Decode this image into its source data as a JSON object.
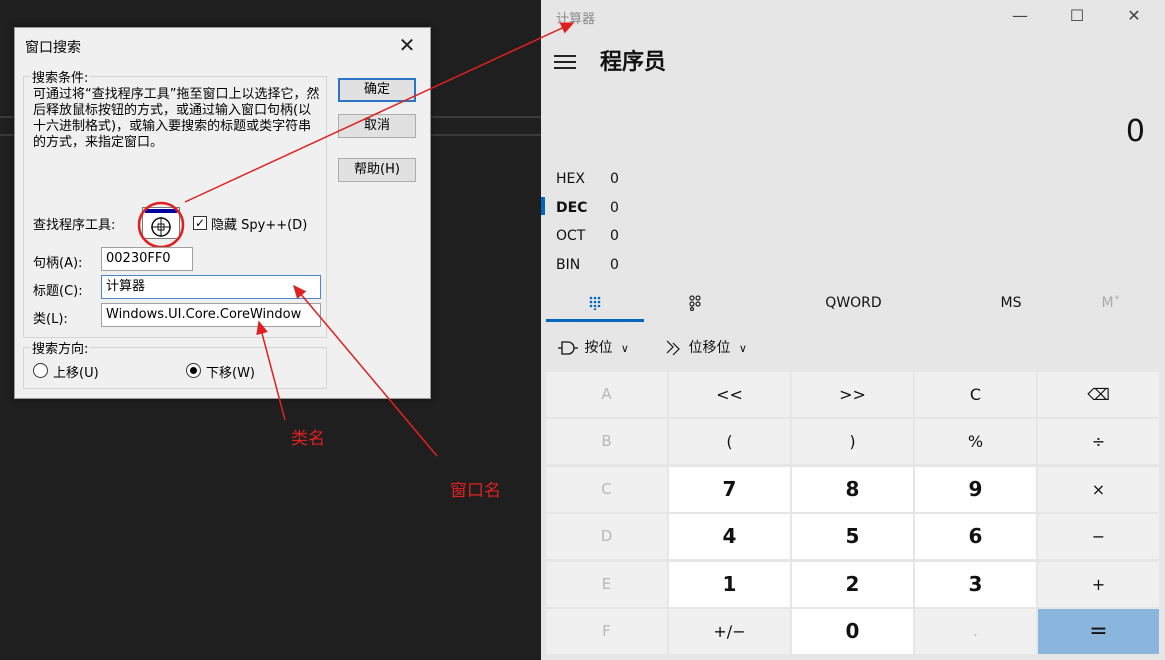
{
  "spy_dialog": {
    "title": "窗口搜索",
    "close_glyph": "✕",
    "criteria_group_label": "搜索条件:",
    "description": "可通过将“查找程序工具”拖至窗口上以选择它，然后释放鼠标按钮的方式，或通过输入窗口句柄(以十六进制格式)，或输入要搜索的标题或类字符串的方式，来指定窗口。",
    "finder_label": "查找程序工具:",
    "hide_spy_label": "隐藏 Spy++(D)",
    "hide_spy_checked": true,
    "handle_label": "句柄(A):",
    "handle_value": "00230FF0",
    "caption_label": "标题(C):",
    "caption_value": "计算器",
    "class_label": "类(L):",
    "class_value": "Windows.UI.Core.CoreWindow",
    "direction_group_label": "搜索方向:",
    "up_label": "上移(U)",
    "down_label": "下移(W)",
    "direction_selected": "down",
    "ok_label": "确定",
    "cancel_label": "取消",
    "help_label": "帮助(H)"
  },
  "annotations": {
    "class_name": "类名",
    "window_name": "窗口名",
    "color": "#e02020"
  },
  "calculator": {
    "title": "计算器",
    "controls": {
      "minimize": "—",
      "maximize": "☐",
      "close": "✕"
    },
    "mode": "程序员",
    "display": "0",
    "bases": [
      {
        "name": "HEX",
        "value": "0"
      },
      {
        "name": "DEC",
        "value": "0"
      },
      {
        "name": "OCT",
        "value": "0"
      },
      {
        "name": "BIN",
        "value": "0"
      }
    ],
    "active_base": "DEC",
    "tabs": {
      "keypad_icon": "keypad-icon",
      "bitflip_icon": "bit-toggle-icon",
      "word": "QWORD",
      "ms": "MS",
      "m_dropdown": "M˅"
    },
    "tools": {
      "bitwise": "按位",
      "bitshift": "位移位"
    },
    "accent": "#0067c0",
    "equals_color": "#8ab5dd",
    "keys": [
      [
        "A",
        "<<",
        ">>",
        "C",
        "⌫"
      ],
      [
        "B",
        "(",
        ")",
        "%",
        "÷"
      ],
      [
        "C",
        "7",
        "8",
        "9",
        "×"
      ],
      [
        "D",
        "4",
        "5",
        "6",
        "−"
      ],
      [
        "E",
        "1",
        "2",
        "3",
        "+"
      ],
      [
        "F",
        "+/−",
        "0",
        ".",
        "="
      ]
    ]
  }
}
